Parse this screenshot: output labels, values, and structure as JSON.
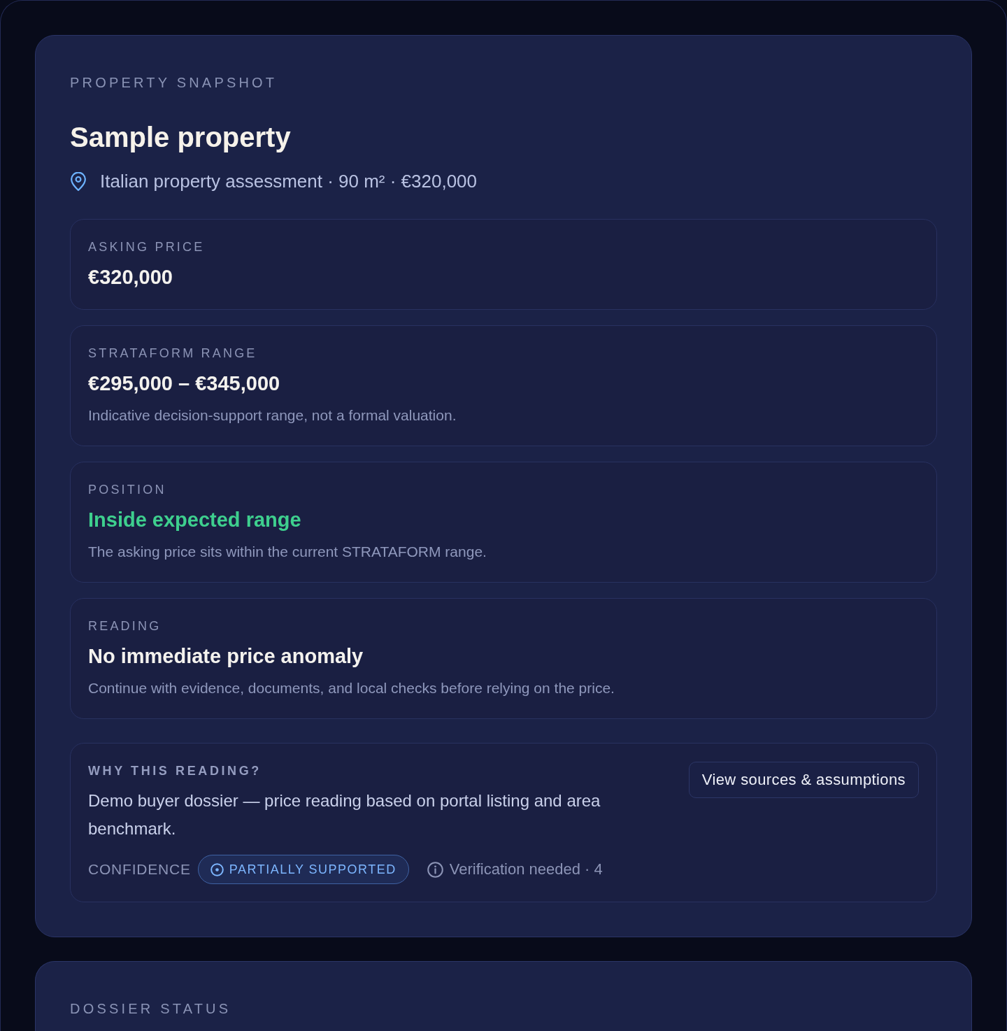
{
  "property_snapshot": {
    "eyebrow": "PROPERTY SNAPSHOT",
    "title": "Sample property",
    "location": "Italian property assessment · 90 m² · €320,000",
    "cards": [
      {
        "label": "ASKING PRICE",
        "value": "€320,000",
        "color": "#f4f2ee"
      },
      {
        "label": "STRATAFORM RANGE",
        "value": "€295,000 – €345,000",
        "note": "Indicative decision-support range, not a formal valuation.",
        "color": "#f4f2ee"
      },
      {
        "label": "POSITION",
        "value": "Inside expected range",
        "note": "The asking price sits within the current STRATAFORM range.",
        "color": "#3ecf8e"
      },
      {
        "label": "READING",
        "value": "No immediate price anomaly",
        "note": "Continue with evidence, documents, and local checks before relying on the price.",
        "color": "#f4f2ee"
      }
    ],
    "why": {
      "label": "WHY THIS READING?",
      "text": "Demo buyer dossier — price reading based on portal listing and area benchmark.",
      "button": "View sources & assumptions",
      "confidence_label": "CONFIDENCE",
      "confidence": "PARTIALLY SUPPORTED",
      "verification": "Verification needed · 4"
    }
  },
  "dossier_status": {
    "eyebrow": "DOSSIER STATUS"
  }
}
